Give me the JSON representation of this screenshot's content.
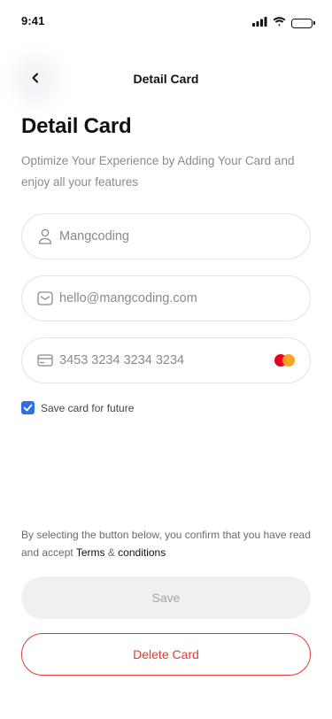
{
  "status_bar": {
    "time": "9:41"
  },
  "nav": {
    "title": "Detail Card"
  },
  "page": {
    "title": "Detail Card",
    "subtitle": "Optimize Your Experience by Adding Your Card and enjoy all your features"
  },
  "form": {
    "name_value": "Mangcoding",
    "email_value": "hello@mangcoding.com",
    "card_number_value": "3453 3234 3234 3234",
    "card_brand_icon": "mastercard-icon",
    "save_card_label": "Save card for future",
    "save_card_checked": true
  },
  "consent": {
    "text_prefix": "By selecting the button below, you confirm that you have read and accept ",
    "terms_label": "Terms",
    "joiner": " & ",
    "conditions_label": "conditions"
  },
  "actions": {
    "save_label": "Save",
    "delete_label": "Delete Card"
  },
  "colors": {
    "accent_blue": "#2f6fe0",
    "danger_red": "#e53935",
    "muted_text": "#8b8b8b",
    "disabled_bg": "#f0f0f0"
  }
}
